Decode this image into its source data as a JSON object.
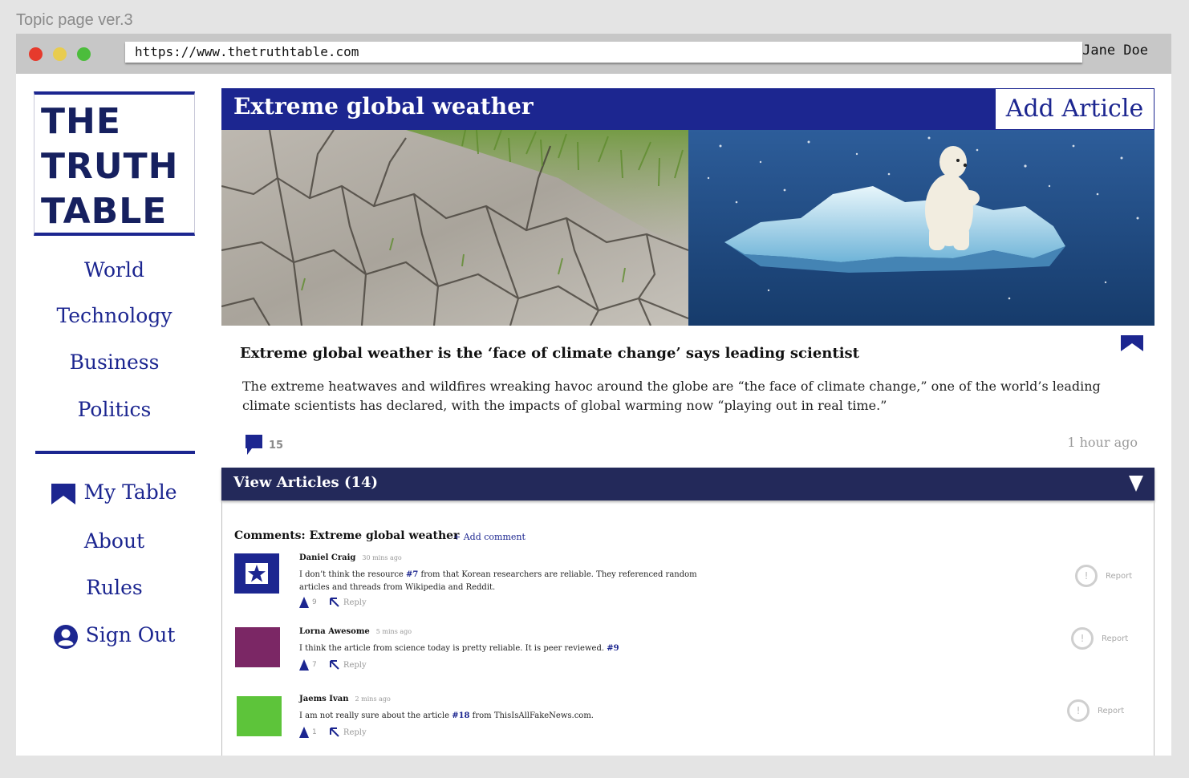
{
  "frame_title": "Topic page ver.3",
  "browser": {
    "url": "https://www.thetruthtable.com",
    "user": "Jane Doe"
  },
  "logo": {
    "line1": "THE",
    "line2": "TRUTH",
    "line3": "TABLE"
  },
  "nav": {
    "world": "World",
    "technology": "Technology",
    "business": "Business",
    "politics": "Politics",
    "my_table": "My Table",
    "about": "About",
    "rules": "Rules",
    "sign_out": "Sign Out"
  },
  "topic": {
    "title": "Extreme global weather",
    "add_article": "Add Article"
  },
  "article": {
    "headline": "Extreme global weather is the ‘face of climate change’ says leading scientist",
    "summary": "The extreme heatwaves and wildfires wreaking havoc around the globe are “the face of climate change,” one of the world’s leading climate scientists has declared, with the impacts of global warming now “playing out in real time.”",
    "comment_count": "15",
    "time_ago": "1 hour ago"
  },
  "view_articles": "View Articles (14)",
  "comments": {
    "title": "Comments: Extreme global weather",
    "add_comment": "+ Add comment",
    "items": [
      {
        "author": "Daniel Craig",
        "time": "30 mins ago",
        "text_before": "I don’t think the resource ",
        "ref": "#7",
        "text_after": " from that Korean researchers are reliable. They referenced random articles and threads from Wikipedia and Reddit.",
        "votes": "9",
        "reply": "Reply",
        "report": "Report",
        "avatar_color": "#1c2690"
      },
      {
        "author": "Lorna Awesome",
        "time": "5 mins ago",
        "text_before": "I think the article from science today is pretty reliable. It is peer reviewed. ",
        "ref": "#9",
        "text_after": "",
        "votes": "7",
        "reply": "Reply",
        "report": "Report",
        "avatar_color": "#7b2765"
      },
      {
        "author": "Jaems Ivan",
        "time": "2 mins ago",
        "text_before": "I am not really sure about the article ",
        "ref": "#18",
        "text_after": " from ThisIsAllFakeNews.com.",
        "votes": "1",
        "reply": "Reply",
        "report": "Report",
        "avatar_color": "#5dc43a"
      }
    ]
  },
  "colors": {
    "brand": "#1c2690",
    "dark_bar": "#23295a",
    "page_bg": "#e4e4e4"
  },
  "icons": [
    "bookmark-icon",
    "user-icon",
    "comment-icon",
    "chevron-down-icon",
    "upvote-icon",
    "reply-icon",
    "report-icon",
    "star-icon"
  ]
}
